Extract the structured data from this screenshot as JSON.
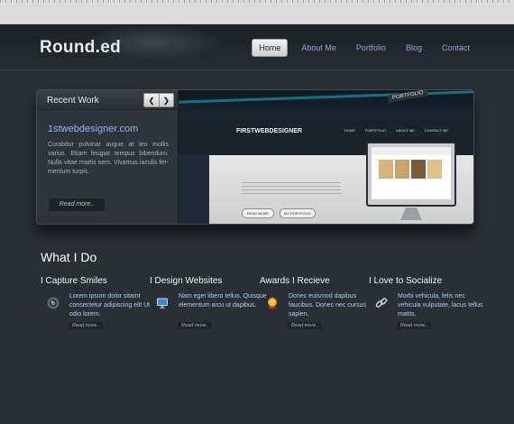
{
  "header": {
    "logo": "Round.ed",
    "nav": [
      "Home",
      "About Me",
      "Portfolio",
      "Blog",
      "Contact"
    ]
  },
  "showcase": {
    "title": "Recent Work",
    "prev_icon": "chevron-left-icon",
    "next_icon": "chevron-right-icon",
    "site_name": "1stwebdesigner.com",
    "description": "Curabitur pulvinar augue at leo mollis varius. Etiam feugiat tempus bibendum. Nulla vitae mattis sem. Vivamus iaculis fer-mentum turpis.",
    "read_more": "Read more..",
    "preview": {
      "tag": "PORTFOLIO",
      "brand": "FIRSTWEBDESIGNER",
      "menu": [
        "HOME",
        "PORTFOLIO",
        "ABOUT ME",
        "CONTACT ME"
      ],
      "btn_read": "READ MORE",
      "btn_portfolio": "MY PORTFOLIO"
    }
  },
  "what_i_do": {
    "title": "What I Do",
    "items": [
      {
        "title": "I Capture Smiles",
        "icon": "camera-lens-icon",
        "desc": "Lorem ipsum dolor sitamt consectetur adipiscing elit Ut odio lorem.",
        "more": "Read more.."
      },
      {
        "title": "I Design Websites",
        "icon": "monitor-icon",
        "desc": "Nam eget libero tellus. Quisque elementum arcu ut dapibus.",
        "more": "Read more.."
      },
      {
        "title": "Awards I Recieve",
        "icon": "award-medal-icon",
        "desc": "Donec euismod dapibus faucibus. Donec nec cursus sapien.",
        "more": "Read more.."
      },
      {
        "title": "I Love to Socialize",
        "icon": "chain-link-icon",
        "desc": "Morbi vehicula, felis nec vehicula vulputate, lacus tellus mattis.",
        "more": "Read more.."
      }
    ]
  }
}
